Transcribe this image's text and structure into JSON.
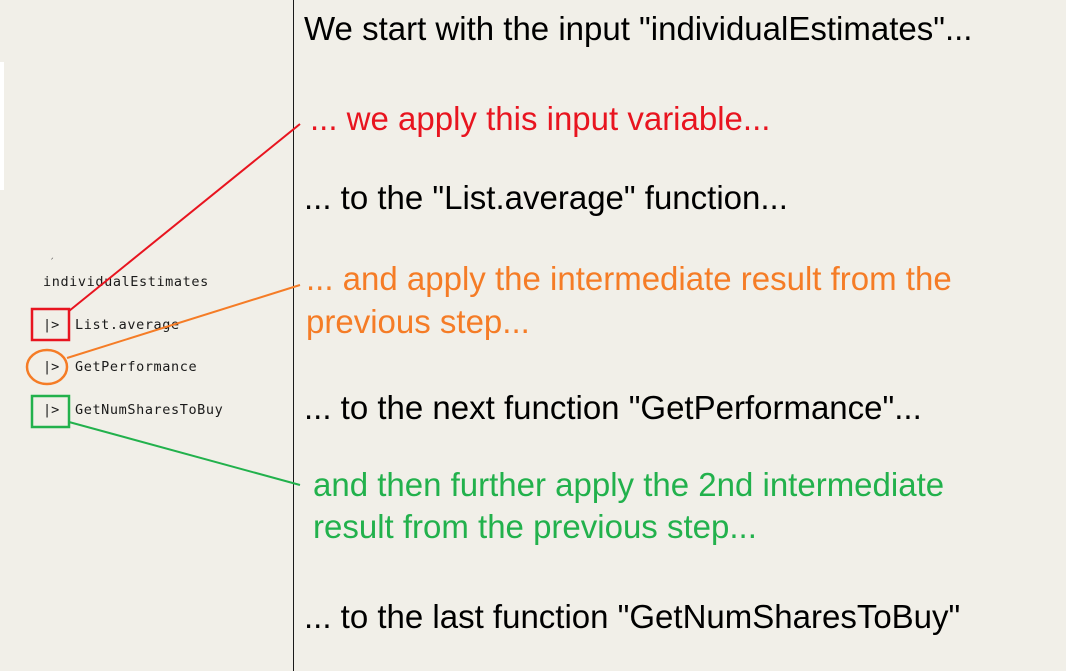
{
  "code": {
    "input": "individualEstimates",
    "pipe_symbol": "|>",
    "steps": [
      "List.average",
      "GetPerformance",
      "GetNumSharesToBuy"
    ]
  },
  "notes": [
    {
      "text": "We start with the input \"individualEstimates\"...",
      "color": "#000000"
    },
    {
      "text": "... we apply this input variable...",
      "color": "#e8141f"
    },
    {
      "text": "... to the \"List.average\" function...",
      "color": "#000000"
    },
    {
      "lines": [
        "... and apply the intermediate result from the",
        "previous step..."
      ],
      "color": "#f57c26"
    },
    {
      "text": "... to the next function \"GetPerformance\"...",
      "color": "#000000"
    },
    {
      "lines": [
        "and then further apply the 2nd intermediate",
        "result from the previous step..."
      ],
      "color": "#22b14c"
    },
    {
      "text": "... to the last function \"GetNumSharesToBuy\"",
      "color": "#000000"
    }
  ],
  "colors": {
    "background": "#f1efe8",
    "divider": "#1a1a1a",
    "red": "#e8141f",
    "orange": "#f57c26",
    "green": "#22b14c"
  }
}
